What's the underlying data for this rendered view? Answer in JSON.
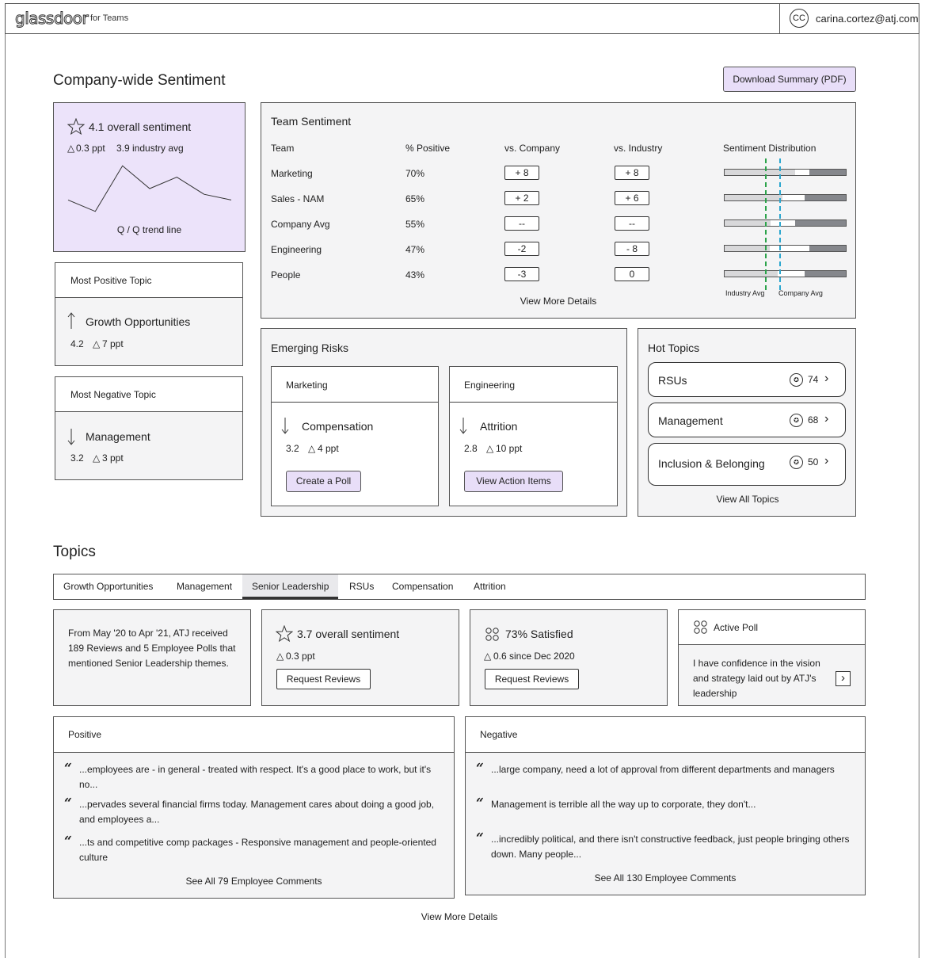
{
  "header": {
    "logo": "glassdoor",
    "logo_sub": "for Teams",
    "avatar_initials": "CC",
    "user_email": "carina.cortez@atj.com"
  },
  "sentiment": {
    "title": "Company-wide Sentiment",
    "download_label": "Download Summary (PDF)",
    "overall_label": "4.1 overall sentiment",
    "delta": "0.3 ppt",
    "industry_avg": "3.9 industry avg",
    "trend_caption": "Q / Q trend line",
    "trend_values": [
      3.7,
      3.5,
      4.3,
      3.9,
      4.1,
      3.8,
      3.7
    ]
  },
  "most_positive": {
    "header": "Most Positive Topic",
    "topic": "Growth Opportunities",
    "score": "4.2",
    "delta": "7 ppt"
  },
  "most_negative": {
    "header": "Most Negative Topic",
    "topic": "Management",
    "score": "3.2",
    "delta": "3 ppt"
  },
  "team_sentiment": {
    "title": "Team Sentiment",
    "columns": [
      "Team",
      "% Positive",
      "vs. Company",
      "vs. Industry",
      "Sentiment Distribution"
    ],
    "rows": [
      {
        "team": "Marketing",
        "pct": "70%",
        "vs_company": "+ 8",
        "vs_industry": "+ 8",
        "dist": [
          0.58,
          0.12,
          0.3
        ]
      },
      {
        "team": "Sales - NAM",
        "pct": "65%",
        "vs_company": "+ 2",
        "vs_industry": "+ 6",
        "dist": [
          0.48,
          0.18,
          0.34
        ]
      },
      {
        "team": "Company Avg",
        "pct": "55%",
        "vs_company": "--",
        "vs_industry": "--",
        "dist": [
          0.38,
          0.2,
          0.42
        ]
      },
      {
        "team": "Engineering",
        "pct": "47%",
        "vs_company": "-2",
        "vs_industry": "- 8",
        "dist": [
          0.37,
          0.33,
          0.3
        ]
      },
      {
        "team": "People",
        "pct": "43%",
        "vs_company": "-3",
        "vs_industry": "0",
        "dist": [
          0.44,
          0.22,
          0.34
        ]
      }
    ],
    "industry_avg_label": "Industry Avg",
    "company_avg_label": "Company Avg",
    "view_more": "View More Details"
  },
  "emerging_risks": {
    "title": "Emerging Risks",
    "items": [
      {
        "team": "Marketing",
        "topic": "Compensation",
        "score": "3.2",
        "delta": "4 ppt",
        "action": "Create a Poll"
      },
      {
        "team": "Engineering",
        "topic": "Attrition",
        "score": "2.8",
        "delta": "10 ppt",
        "action": "View Action Items"
      }
    ]
  },
  "hot_topics": {
    "title": "Hot Topics",
    "items": [
      {
        "label": "RSUs",
        "count": "74"
      },
      {
        "label": "Management",
        "count": "68"
      },
      {
        "label": "Inclusion & Belonging",
        "count": "50"
      }
    ],
    "view_all": "View All Topics"
  },
  "topics": {
    "title": "Topics",
    "tabs": [
      "Growth Opportunities",
      "Management",
      "Senior Leadership",
      "RSUs",
      "Compensation",
      "Attrition"
    ],
    "active_tab": "Senior Leadership",
    "summary_text": "From May '20 to Apr '21, ATJ received 189 Reviews and 5 Employee Polls that mentioned Senior Leadership themes.",
    "overall_label": "3.7 overall sentiment",
    "overall_delta": "0.3 ppt",
    "request_reviews": "Request Reviews",
    "satisfied_label": "73% Satisfied",
    "satisfied_delta": "0.6 since Dec 2020",
    "active_poll_label": "Active Poll",
    "poll_question": "I have confidence in the vision and strategy laid out by ATJ's leadership"
  },
  "positive": {
    "header": "Positive",
    "quotes": [
      "...employees are - in general - treated with respect. It's a good place to work, but it's no...",
      "...pervades several financial firms today. Management cares about doing a good job, and employees a...",
      "...ts and competitive comp packages - Responsive management and people-oriented culture"
    ],
    "see_all": "See All 79 Employee Comments"
  },
  "negative": {
    "header": "Negative",
    "quotes": [
      "...large company, need a lot of approval from different departments and managers",
      "Management is terrible all the way up to corporate, they don't...",
      "...incredibly political, and there isn't constructive feedback, just people bringing others down. Many people..."
    ],
    "see_all": "See All 130 Employee Comments"
  },
  "footer": {
    "view_more": "View More Details"
  },
  "colors": {
    "accent_purple": "#e8def8",
    "industry_line": "#2ba34a",
    "company_line": "#2aa6cf"
  }
}
